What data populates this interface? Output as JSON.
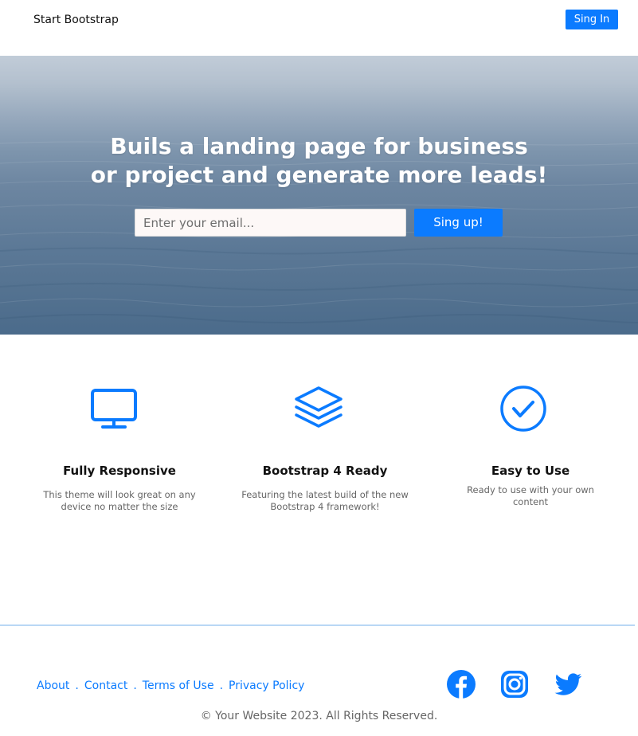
{
  "navbar": {
    "brand": "Start Bootstrap",
    "signin_label": "Sing In"
  },
  "hero": {
    "title_line1": "Buils a landing page for business",
    "title_line2": "or project and generate more leads!",
    "email_placeholder": "Enter your email...",
    "signup_label": "Sing up!"
  },
  "features": [
    {
      "icon": "monitor-icon",
      "title": "Fully Responsive",
      "desc_line1": "This theme will look great on any",
      "desc_line2": "device no matter the size"
    },
    {
      "icon": "layers-icon",
      "title": "Bootstrap 4 Ready",
      "desc_line1": "Featuring the latest build of the new",
      "desc_line2": "Bootstrap 4 framework!"
    },
    {
      "icon": "check-circle-icon",
      "title": "Easy to Use",
      "desc_line1": "Ready to use with your own",
      "desc_line2": "content"
    }
  ],
  "footer": {
    "links": [
      "About",
      "Contact",
      "Terms of Use",
      "Privacy Policy"
    ],
    "separator": ".",
    "social": [
      "facebook-icon",
      "instagram-icon",
      "twitter-icon"
    ],
    "copyright": "© Your Website 2023. All Rights Reserved."
  },
  "colors": {
    "accent": "#0b7bff",
    "divider": "#b9d7f5",
    "hero_top": "#c1ccd8",
    "hero_bottom": "#4b6b8b"
  }
}
